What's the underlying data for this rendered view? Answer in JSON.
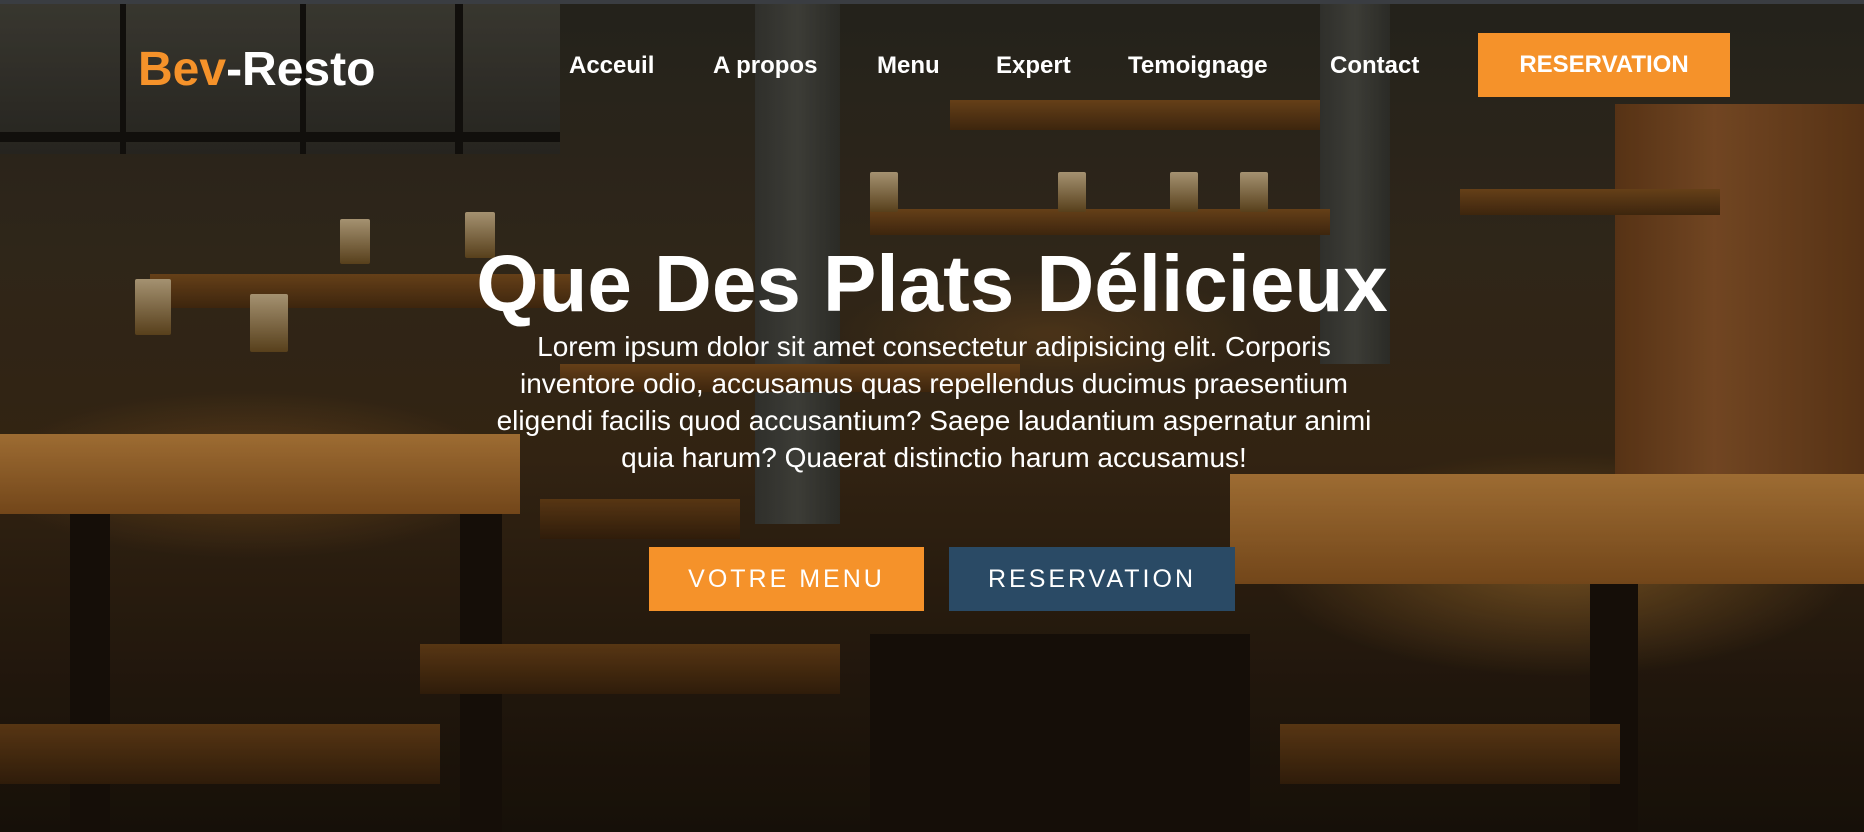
{
  "brand": {
    "part1": "Bev",
    "part2": "-Resto",
    "accent_color": "#f5922a"
  },
  "nav": {
    "items": [
      {
        "label": "Acceuil"
      },
      {
        "label": "A propos"
      },
      {
        "label": "Menu"
      },
      {
        "label": "Expert"
      },
      {
        "label": "Temoignage"
      },
      {
        "label": "Contact"
      }
    ],
    "cta_label": "RESERVATION"
  },
  "hero": {
    "title": "Que Des Plats Délicieux",
    "text": "Lorem ipsum dolor sit amet consectetur adipisicing elit. Corporis inventore odio, accusamus quas repellendus ducimus praesentium eligendi facilis quod accusantium? Saepe laudantium aspernatur animi quia harum? Quaerat distinctio harum accusamus!",
    "primary_button": "VOTRE MENU",
    "secondary_button": "RESERVATION",
    "primary_color": "#f5922a",
    "secondary_color": "#2a4a65",
    "background_image": "restaurant-interior"
  }
}
